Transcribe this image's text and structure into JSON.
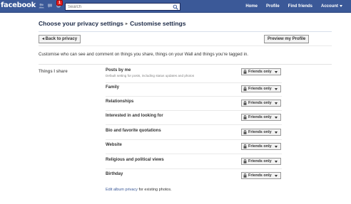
{
  "topbar": {
    "logo": "facebook",
    "notification_count": "1",
    "search_placeholder": "Search",
    "nav": [
      "Home",
      "Profile",
      "Find friends",
      "Account"
    ]
  },
  "header": {
    "crumb_parent": "Choose your privacy settings",
    "crumb_separator": "▸",
    "crumb_current": "Customise settings",
    "back_button": "◂ Back to privacy",
    "preview_button": "Preview my Profile"
  },
  "intro": "Customise who can see and comment on things you share, things on your Wall and things you're tagged in.",
  "section_label": "Things I share",
  "rows": [
    {
      "name": "Posts by me",
      "desc": "Default setting for posts, including status updates and photos",
      "value": "Friends only"
    },
    {
      "name": "Family",
      "desc": "",
      "value": "Friends only"
    },
    {
      "name": "Relationships",
      "desc": "",
      "value": "Friends only"
    },
    {
      "name": "Interested in and looking for",
      "desc": "",
      "value": "Friends only"
    },
    {
      "name": "Bio and favorite quotations",
      "desc": "",
      "value": "Friends only"
    },
    {
      "name": "Website",
      "desc": "",
      "value": "Friends only"
    },
    {
      "name": "Religious and political views",
      "desc": "",
      "value": "Friends only"
    },
    {
      "name": "Birthday",
      "desc": "",
      "value": "Friends only"
    }
  ],
  "footnote": {
    "link": "Edit album privacy",
    "text": " for existing photos."
  },
  "colors": {
    "topbar": "#3b5998",
    "link": "#3b5998",
    "badge": "#e41f1f"
  },
  "icons": [
    "friends-icon",
    "messages-icon",
    "notifications-icon",
    "search-icon",
    "lock-icon",
    "chevron-down-icon"
  ]
}
